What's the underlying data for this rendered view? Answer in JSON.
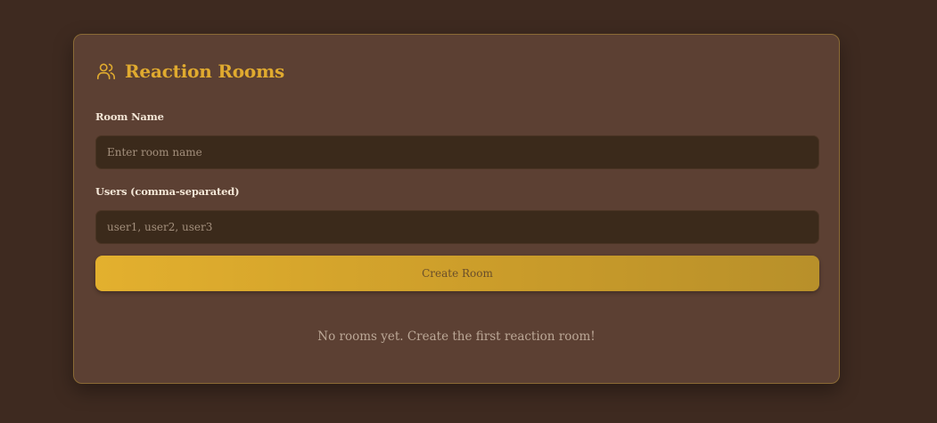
{
  "panel": {
    "title": "Reaction Rooms",
    "icon": "users-icon"
  },
  "form": {
    "room_name_label": "Room Name",
    "room_name_placeholder": "Enter room name",
    "users_label": "Users (comma-separated)",
    "users_placeholder": "user1, user2, user3",
    "create_button_label": "Create Room"
  },
  "rooms": {
    "empty_message": "No rooms yet. Create the first reaction room!"
  },
  "colors": {
    "background": "#3e2a20",
    "card": "#5c4033",
    "accent": "#e0aa2f",
    "input": "#3b2a1b"
  }
}
